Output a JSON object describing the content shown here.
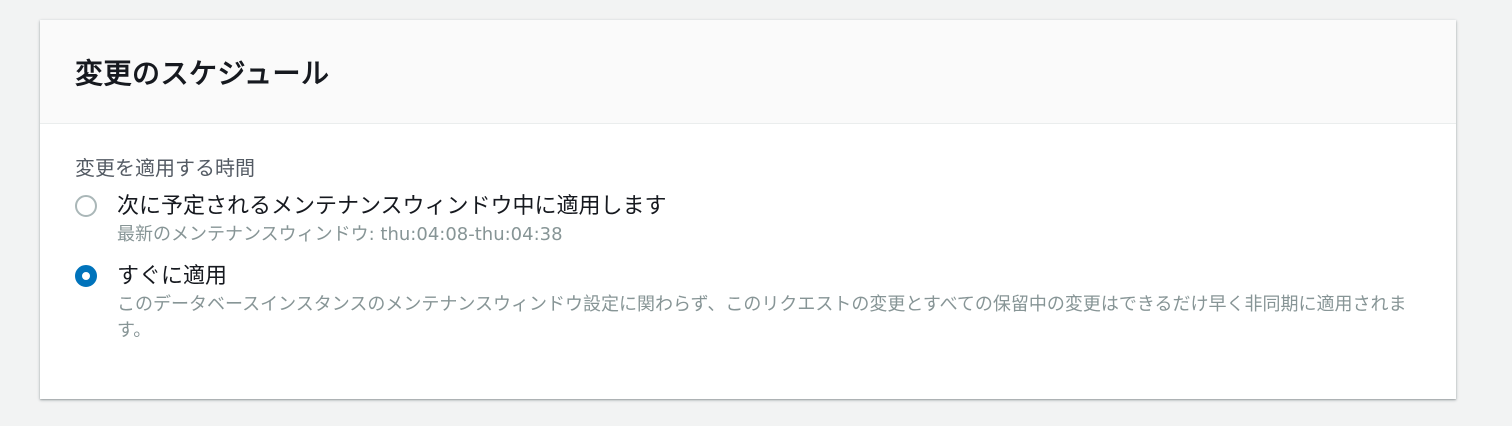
{
  "card": {
    "title": "変更のスケジュール",
    "field_label": "変更を適用する時間",
    "options": [
      {
        "label": "次に予定されるメンテナンスウィンドウ中に適用します",
        "description": "最新のメンテナンスウィンドウ: thu:04:08-thu:04:38",
        "selected": false
      },
      {
        "label": "すぐに適用",
        "description": "このデータベースインスタンスのメンテナンスウィンドウ設定に関わらず、このリクエストの変更とすべての保留中の変更はできるだけ早く非同期に適用されます。",
        "selected": true
      }
    ]
  },
  "colors": {
    "accent": "#0073bb",
    "title_text": "#16191f",
    "secondary_text": "#879596",
    "label_text": "#545b64"
  }
}
